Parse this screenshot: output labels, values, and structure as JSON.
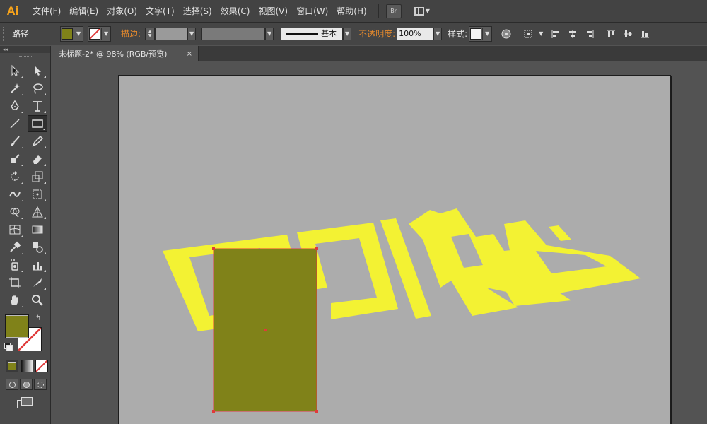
{
  "app": {
    "logo": "Ai"
  },
  "menu": [
    "文件(F)",
    "编辑(E)",
    "对象(O)",
    "文字(T)",
    "选择(S)",
    "效果(C)",
    "视图(V)",
    "窗口(W)",
    "帮助(H)"
  ],
  "bridge_label": "Br",
  "control": {
    "object_type": "路径",
    "stroke_label": "描边:",
    "brush_label": "基本",
    "opacity_label": "不透明度:",
    "opacity_value": "100%",
    "style_label": "样式:"
  },
  "document_tab": {
    "title": "未标题-2* @ 98% (RGB/预览)",
    "close": "×"
  },
  "colors": {
    "fill": "#808219",
    "text_shape": "#f3f233",
    "artboard": "#acacac",
    "selection": "#e03a3a"
  }
}
